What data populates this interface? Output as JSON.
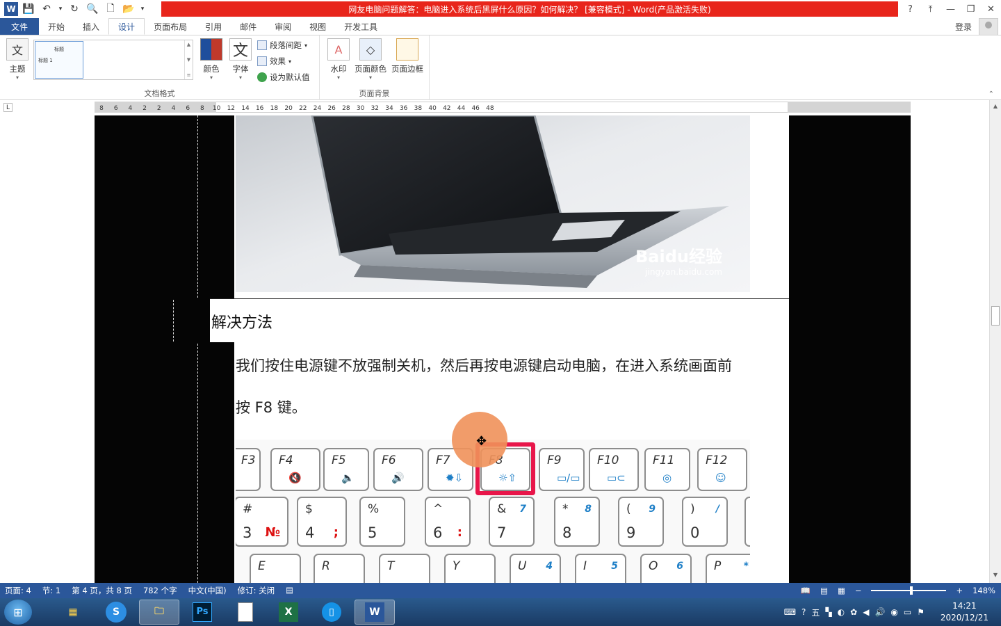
{
  "window": {
    "title": "网友电脑问题解答：电脑进入系统后黑屏什么原因？如何解决？ [兼容模式] - Word(产品激活失败)",
    "help": "?",
    "ribbon_display": "⤒",
    "minimize": "—",
    "restore": "❐",
    "close": "✕"
  },
  "qat": {
    "word": "W",
    "save": "💾",
    "undo": "↶",
    "undo_dropdown": "▾",
    "redo": "↻",
    "preview": "🔍",
    "new": "🗋",
    "open": "📂",
    "customize": "▾"
  },
  "tabs": [
    "文件",
    "开始",
    "插入",
    "设计",
    "页面布局",
    "引用",
    "邮件",
    "审阅",
    "视图",
    "开发工具"
  ],
  "active_tab": "设计",
  "account": {
    "login": "登录"
  },
  "ribbon": {
    "doc_format_group": "文档格式",
    "theme": "主题",
    "gallery_item_title": "标题",
    "gallery_item_heading": "标题 1",
    "colors": "颜色",
    "fonts": "字体",
    "para_spacing": "段落间距",
    "effects": "效果",
    "set_default": "设为默认值",
    "page_bg_group": "页面背景",
    "watermark": "水印",
    "page_color": "页面颜色",
    "page_border": "页面边框"
  },
  "ruler": {
    "ticks": [
      "8",
      "6",
      "4",
      "2",
      "2",
      "4",
      "6",
      "8",
      "10",
      "12",
      "14",
      "16",
      "18",
      "20",
      "22",
      "24",
      "26",
      "28",
      "30",
      "32",
      "34",
      "36",
      "38",
      "40",
      "42",
      "44",
      "46",
      "48"
    ]
  },
  "document": {
    "heading": "解决方法",
    "para1": "我们按住电源键不放强制关机，然后再按电源键启动电脑，在进入系统画面前",
    "para2": "按 F8 键。",
    "watermark_brand": "Baidu经验",
    "watermark_url": "jingyan.baidu.com",
    "fkeys": [
      "F3",
      "F4",
      "F5",
      "F6",
      "F7",
      "F8",
      "F9",
      "F10",
      "F11",
      "F12"
    ],
    "num_keys": [
      {
        "top": "#",
        "main": "3",
        "extra": "№"
      },
      {
        "top": "$",
        "main": "4",
        "extra": ";"
      },
      {
        "top": "%",
        "main": "5",
        "extra": ""
      },
      {
        "top": "^",
        "main": "6",
        "extra": ":"
      },
      {
        "top": "&",
        "main": "7",
        "extra": "7"
      },
      {
        "top": "*",
        "main": "8",
        "extra": "8"
      },
      {
        "top": "(",
        "main": "9",
        "extra": "9"
      },
      {
        "top": ")",
        "main": "0",
        "extra": "/"
      }
    ],
    "letter_keys": [
      "E",
      "R",
      "T",
      "Y",
      "U",
      "I",
      "O",
      "P"
    ],
    "letter_extras": [
      "",
      "",
      "",
      "",
      "4",
      "5",
      "6",
      "*"
    ]
  },
  "status": {
    "page": "页面: 4",
    "section": "节: 1",
    "pages": "第 4 页，共 8 页",
    "words": "782 个字",
    "language": "中文(中国)",
    "track": "修订: 关闭",
    "zoom": "148%",
    "zoom_minus": "−",
    "zoom_plus": "+"
  },
  "taskbar": {
    "time": "14:21",
    "date": "2020/12/21",
    "apps": [
      "explorer",
      "sogou",
      "folder",
      "Ps",
      "notepad",
      "X",
      "phone",
      "W"
    ]
  },
  "colors": {
    "word_blue": "#2b579a",
    "title_red": "#e8251b",
    "highlight_pink": "#e8164a"
  }
}
